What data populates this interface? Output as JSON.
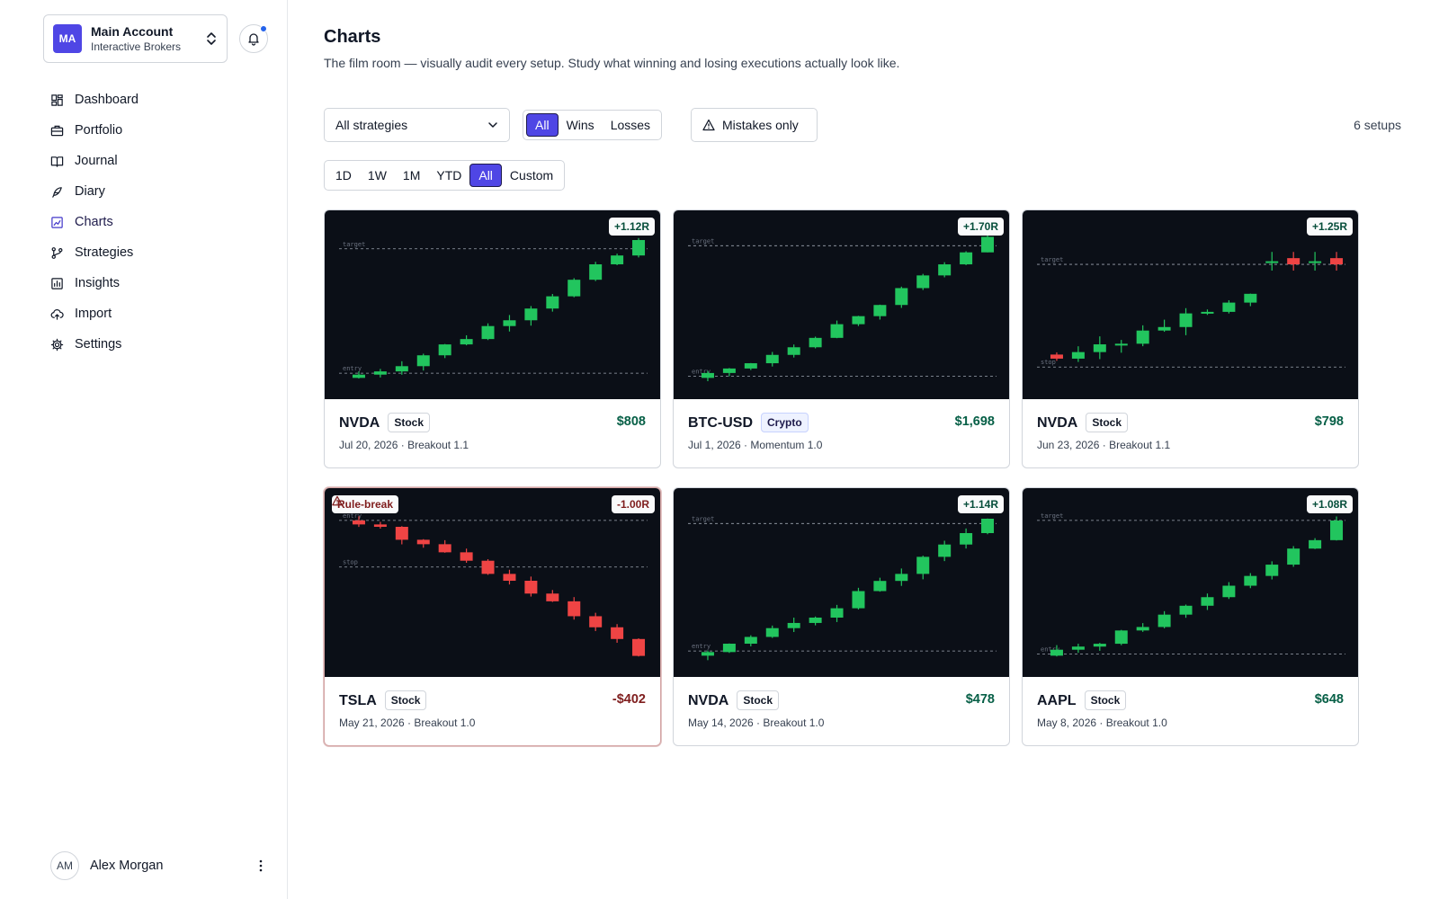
{
  "account": {
    "initials": "MA",
    "name": "Main Account",
    "broker": "Interactive Brokers"
  },
  "nav": [
    {
      "label": "Dashboard",
      "icon": "dashboard-icon"
    },
    {
      "label": "Portfolio",
      "icon": "briefcase-icon"
    },
    {
      "label": "Journal",
      "icon": "book-icon"
    },
    {
      "label": "Diary",
      "icon": "feather-icon"
    },
    {
      "label": "Charts",
      "icon": "chart-icon",
      "active": true
    },
    {
      "label": "Strategies",
      "icon": "git-branch-icon"
    },
    {
      "label": "Insights",
      "icon": "bar-chart-icon"
    },
    {
      "label": "Import",
      "icon": "cloud-upload-icon"
    },
    {
      "label": "Settings",
      "icon": "gear-icon"
    }
  ],
  "user": {
    "initials": "AM",
    "name": "Alex Morgan"
  },
  "page": {
    "title": "Charts",
    "subtitle": "The film room — visually audit every setup. Study what winning and losing executions actually look like."
  },
  "filters": {
    "strategy": "All strategies",
    "outcome": [
      "All",
      "Wins",
      "Losses"
    ],
    "outcome_active": "All",
    "mistakes_label": "Mistakes only",
    "ranges": [
      "1D",
      "1W",
      "1M",
      "YTD",
      "All",
      "Custom"
    ],
    "range_active": "All",
    "count": "6 setups"
  },
  "colors": {
    "accent": "#4f46e5",
    "up": "#22c55e",
    "down": "#ef4444",
    "chart_bg": "#0b0f17"
  },
  "cards": [
    {
      "symbol": "NVDA",
      "type": "Stock",
      "pnl": "$808",
      "r": "+1.12R",
      "date": "Jul 20, 2026",
      "strategy": "Breakout 1.1"
    },
    {
      "symbol": "BTC-USD",
      "type": "Crypto",
      "pnl": "$1,698",
      "r": "+1.70R",
      "date": "Jul 1, 2026",
      "strategy": "Momentum 1.0"
    },
    {
      "symbol": "NVDA",
      "type": "Stock",
      "pnl": "$798",
      "r": "+1.25R",
      "date": "Jun 23, 2026",
      "strategy": "Breakout 1.1"
    },
    {
      "symbol": "TSLA",
      "type": "Stock",
      "pnl": "-$402",
      "r": "-1.00R",
      "date": "May 21, 2026",
      "strategy": "Breakout 1.0",
      "rule_break": "Rule-break"
    },
    {
      "symbol": "NVDA",
      "type": "Stock",
      "pnl": "$478",
      "r": "+1.14R",
      "date": "May 14, 2026",
      "strategy": "Breakout 1.0"
    },
    {
      "symbol": "AAPL",
      "type": "Stock",
      "pnl": "$648",
      "r": "+1.08R",
      "date": "May 8, 2026",
      "strategy": "Breakout 1.0"
    }
  ]
}
